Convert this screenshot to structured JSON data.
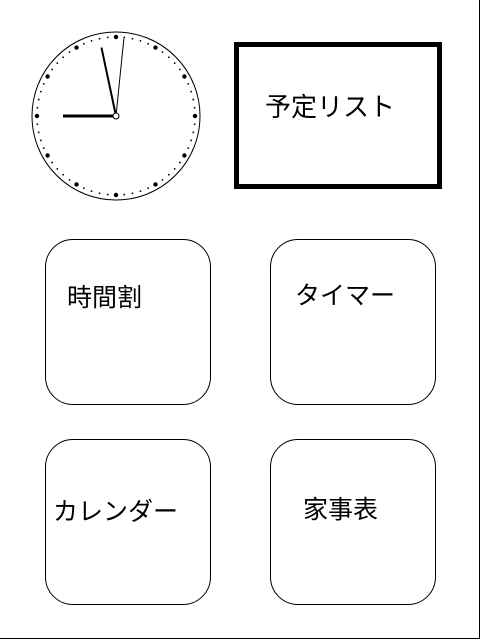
{
  "clock": {
    "hour": 9,
    "minute": 0,
    "second": 58
  },
  "menu": {
    "schedule_list_label": "予定リスト",
    "tiles": [
      {
        "id": "timetable",
        "label": "時間割"
      },
      {
        "id": "timer",
        "label": "タイマー"
      },
      {
        "id": "calendar",
        "label": "カレンダー"
      },
      {
        "id": "chores",
        "label": "家事表"
      }
    ]
  }
}
